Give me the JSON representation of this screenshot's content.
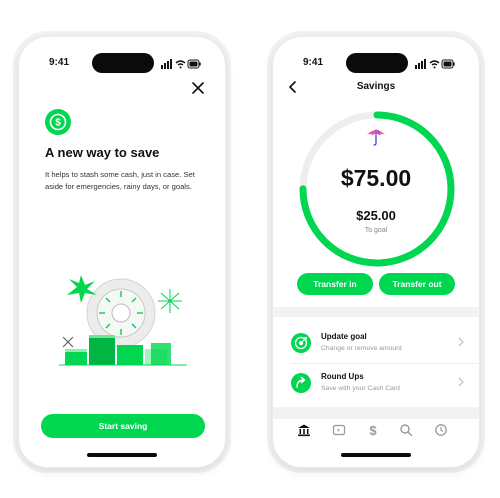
{
  "colors": {
    "accent": "#00d64f",
    "text": "#111111",
    "muted": "#999999",
    "umbrella": "#e05aa8"
  },
  "left_phone": {
    "status": {
      "time": "9:41"
    },
    "icons": {
      "brand": "cash-app-dollar-icon",
      "close": "close-icon"
    },
    "headline": "A new way to save",
    "body": "It helps to stash some cash, just in case. Set aside for emergencies, rainy days, or goals.",
    "cta_label": "Start saving"
  },
  "right_phone": {
    "status": {
      "time": "9:41"
    },
    "nav": {
      "title": "Savings"
    },
    "balance": "$75.00",
    "goal": {
      "amount": "$25.00",
      "caption": "To goal",
      "progress": 0.75
    },
    "buttons": {
      "transfer_in": "Transfer in",
      "transfer_out": "Transfer out"
    },
    "rows": [
      {
        "title": "Update goal",
        "subtitle": "Change or remove amount",
        "icon": "target-icon"
      },
      {
        "title": "Round Ups",
        "subtitle": "Save with your Cash Card",
        "icon": "round-up-arrow-icon"
      }
    ],
    "tabs": [
      {
        "icon": "bank-icon",
        "active": true
      },
      {
        "icon": "card-icon",
        "active": false
      },
      {
        "icon": "dollar-icon",
        "active": false
      },
      {
        "icon": "search-icon",
        "active": false
      },
      {
        "icon": "activity-clock-icon",
        "active": false
      }
    ]
  }
}
